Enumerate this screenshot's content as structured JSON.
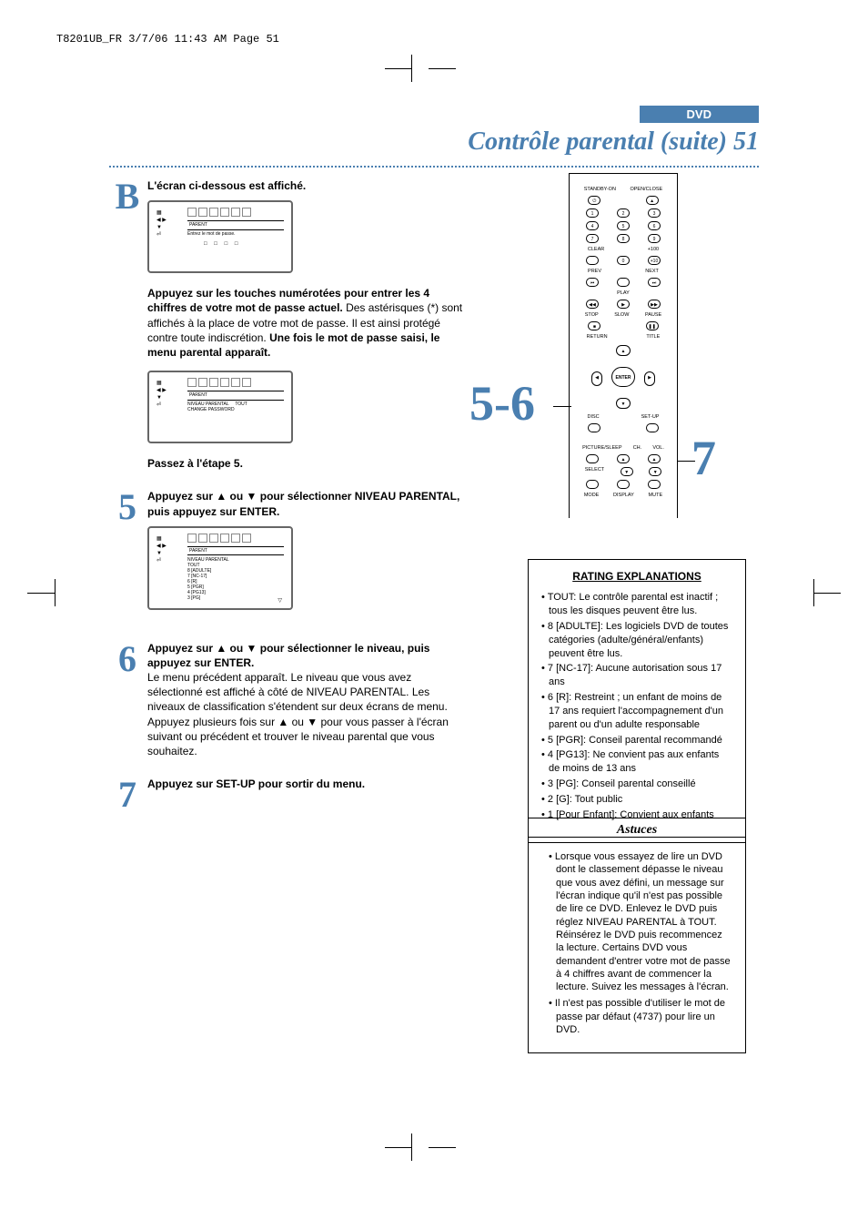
{
  "print_header": "T8201UB_FR  3/7/06  11:43 AM  Page 51",
  "section_tag": "DVD",
  "page_title": "Contrôle parental (suite)  51",
  "big_callouts": {
    "five_six": "5-6",
    "seven": "7"
  },
  "steps": {
    "B": {
      "marker": "B",
      "lead": "L'écran ci-dessous est affiché.",
      "screen": {
        "bar": "PARENT",
        "inner": "Entrez le mot de passe."
      },
      "para1_a": "Appuyez sur les touches numérotées pour entrer les 4 chiffres de votre mot de passe actuel.",
      "para1_b": "  Des astérisques (*) sont affichés à la place de votre mot de passe.  Il est ainsi protégé contre toute indiscrétion.  ",
      "para1_c": "Une fois le mot de passe saisi, le menu parental apparaît.",
      "screen2": {
        "bar": "PARENT",
        "inner": "NIVEAU PARENTAL     TOUT\nCHANGE PASSWORD"
      },
      "after2": "Passez à l'étape 5."
    },
    "5": {
      "marker": "5",
      "bold": "Appuyez sur ▲ ou ▼ pour sélectionner NIVEAU PARENTAL, puis appuyez sur ENTER.",
      "screen": {
        "bar": "PARENT",
        "inner": "NIVEAU PARENTAL\nTOUT\n8 [ADULTE]\n7 [NC-17]\n6 [R]\n5 [PGR]\n4 [PG13]\n3 [PG]"
      }
    },
    "6": {
      "marker": "6",
      "bold": "Appuyez sur ▲ ou ▼ pour sélectionner le niveau, puis appuyez sur ENTER.",
      "body": "Le menu précédent apparaît. Le niveau que vous avez sélectionné est affiché à côté de NIVEAU PARENTAL. Les niveaux de classification s'étendent sur deux écrans de menu.  Appuyez plusieurs fois sur ▲ ou ▼ pour vous passer à l'écran suivant ou précédent et trouver le niveau parental que vous souhaitez."
    },
    "7": {
      "marker": "7",
      "bold": "Appuyez sur SET-UP pour sortir du menu."
    }
  },
  "remote": {
    "top_labels": {
      "standby": "STANDBY-ON",
      "open": "OPEN/CLOSE"
    },
    "numbers": [
      "1",
      "2",
      "3",
      "4",
      "5",
      "6",
      "7",
      "8",
      "9",
      "0"
    ],
    "clear": "CLEAR",
    "plus100": "+100",
    "plus10": "+10",
    "prev": "PREV",
    "next": "NEXT",
    "play": "PLAY",
    "stop": "STOP",
    "slow": "SLOW",
    "pause": "PAUSE",
    "return": "RETURN",
    "title": "TITLE",
    "enter": "ENTER",
    "disc": "DISC",
    "setup": "SET-UP",
    "picture": "PICTURE/SLEEP",
    "ch": "CH.",
    "vol": "VOL.",
    "select": "SELECT",
    "mode": "MODE",
    "display": "DISPLAY",
    "mute": "MUTE"
  },
  "ratings": {
    "title": "RATING EXPLANATIONS",
    "items": [
      "TOUT: Le contrôle parental est inactif ; tous les disques peuvent être lus.",
      "8 [ADULTE]: Les logiciels DVD de toutes catégories (adulte/général/enfants) peuvent être lus.",
      "7 [NC-17]: Aucune autorisation sous 17 ans",
      "6 [R]: Restreint ; un enfant de moins de 17 ans requiert l'accompagnement d'un parent ou d'un adulte responsable",
      "5 [PGR]: Conseil parental recommandé",
      "4 [PG13]: Ne convient pas aux enfants de moins de 13 ans",
      "3 [PG]: Conseil parental conseillé",
      "2 [G]: Tout public",
      "1 [Pour Enfant]: Convient aux enfants"
    ]
  },
  "tips": {
    "title": "Astuces",
    "items": [
      "Lorsque vous essayez de lire un DVD dont le classement dépasse le niveau que vous avez défini, un message sur l'écran indique qu'il n'est pas possible de lire ce DVD. Enlevez le DVD puis réglez NIVEAU PARENTAL à TOUT. Réinsérez le DVD puis recommencez la lecture. Certains DVD vous demandent d'entrer votre mot de passe à 4 chiffres avant de commencer la lecture. Suivez les messages à l'écran.",
      "Il n'est pas possible d'utiliser le mot de passe par défaut (4737) pour lire un DVD."
    ]
  }
}
